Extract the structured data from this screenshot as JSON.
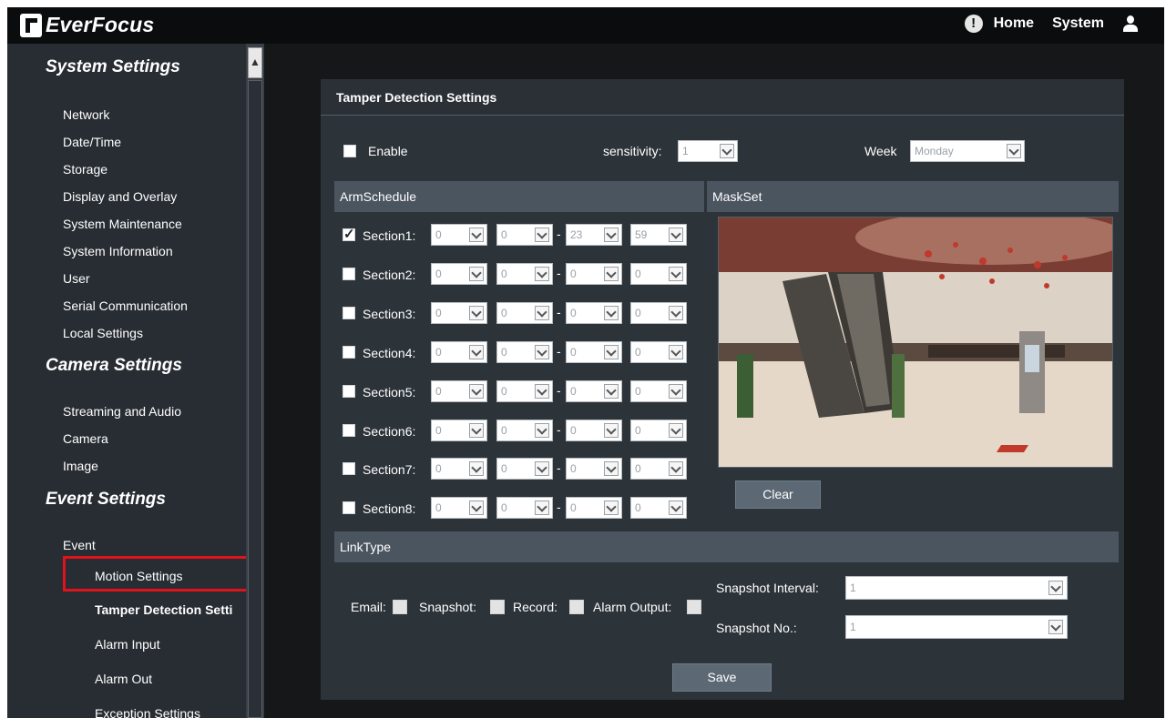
{
  "brand": {
    "logo_text": "EverFocus"
  },
  "topnav": {
    "home": "Home",
    "system": "System"
  },
  "sidebar": {
    "system_title": "System Settings",
    "system_items": [
      "Network",
      "Date/Time",
      "Storage",
      "Display and Overlay",
      "System Maintenance",
      "System Information",
      "User",
      "Serial Communication",
      "Local Settings"
    ],
    "camera_title": "Camera Settings",
    "camera_items": [
      "Streaming and Audio",
      "Camera",
      "Image"
    ],
    "event_title": "Event Settings",
    "event_item": "Event",
    "event_sub_items": [
      "Motion Settings",
      "Tamper Detection Setti",
      "Alarm Input",
      "Alarm Out",
      "Exception Settings"
    ]
  },
  "panel": {
    "title": "Tamper Detection Settings",
    "enable_label": "Enable",
    "sensitivity_label": "sensitivity:",
    "sensitivity_value": "1",
    "week_label": "Week",
    "week_value": "Monday",
    "arm_schedule_label": "ArmSchedule",
    "maskset_label": "MaskSet",
    "sections": [
      {
        "label": "Section1:",
        "checked": true,
        "v1": "0",
        "v2": "0",
        "v3": "23",
        "v4": "59"
      },
      {
        "label": "Section2:",
        "checked": false,
        "v1": "0",
        "v2": "0",
        "v3": "0",
        "v4": "0"
      },
      {
        "label": "Section3:",
        "checked": false,
        "v1": "0",
        "v2": "0",
        "v3": "0",
        "v4": "0"
      },
      {
        "label": "Section4:",
        "checked": false,
        "v1": "0",
        "v2": "0",
        "v3": "0",
        "v4": "0"
      },
      {
        "label": "Section5:",
        "checked": false,
        "v1": "0",
        "v2": "0",
        "v3": "0",
        "v4": "0"
      },
      {
        "label": "Section6:",
        "checked": false,
        "v1": "0",
        "v2": "0",
        "v3": "0",
        "v4": "0"
      },
      {
        "label": "Section7:",
        "checked": false,
        "v1": "0",
        "v2": "0",
        "v3": "0",
        "v4": "0"
      },
      {
        "label": "Section8:",
        "checked": false,
        "v1": "0",
        "v2": "0",
        "v3": "0",
        "v4": "0"
      }
    ],
    "clear_label": "Clear",
    "linktype_label": "LinkType",
    "email_label": "Email:",
    "snapshot_label": "Snapshot:",
    "record_label": "Record:",
    "alarm_output_label": "Alarm Output:",
    "snapshot_interval_label": "Snapshot Interval:",
    "snapshot_interval_value": "1",
    "snapshot_no_label": "Snapshot No.:",
    "snapshot_no_value": "1",
    "save_label": "Save"
  }
}
